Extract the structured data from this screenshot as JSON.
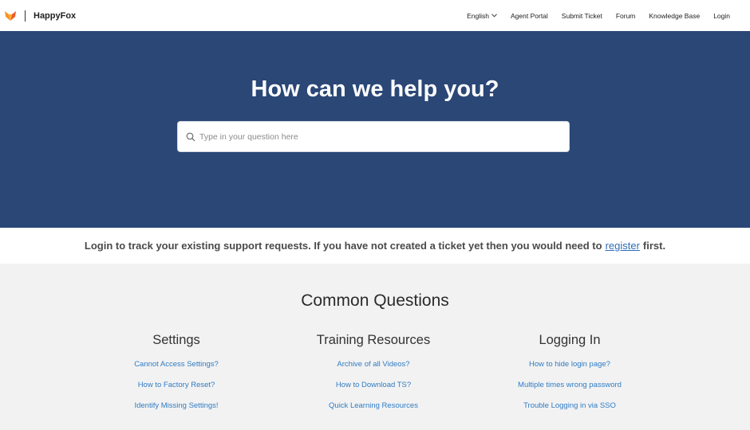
{
  "header": {
    "brand_name": "HappyFox",
    "logo_icon": "fox-logo-icon",
    "language": "English",
    "nav": [
      "Agent Portal",
      "Submit Ticket",
      "Forum",
      "Knowledge Base",
      "Login"
    ]
  },
  "hero": {
    "title": "How can we help you?",
    "search_placeholder": "Type in your question here",
    "bg_color": "#2a4776"
  },
  "login_strip": {
    "text_before": "Login to track your existing support requests. If you have not created a ticket yet then you would need to",
    "link": "register",
    "text_after": "first."
  },
  "common_questions": {
    "title": "Common Questions",
    "categories": [
      {
        "title": "Settings",
        "links": [
          "Cannot Access Settings?",
          "How to Factory Reset?",
          "Identify Missing Settings!"
        ]
      },
      {
        "title": "Training Resources",
        "links": [
          "Archive of all Videos?",
          "How to Download TS?",
          "Quick Learning Resources"
        ]
      },
      {
        "title": "Logging In",
        "links": [
          "How to hide login page?",
          "Multiple times wrong password",
          "Trouble Logging in via SSO"
        ]
      }
    ]
  }
}
